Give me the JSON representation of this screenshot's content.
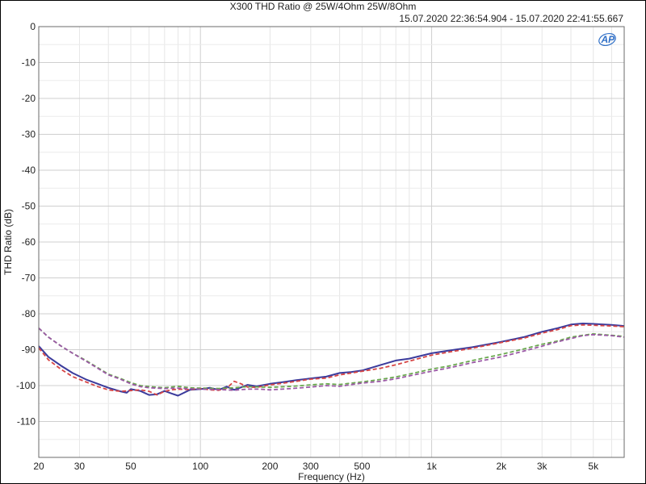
{
  "header": {
    "title": "X300 THD Ratio @ 25W/4Ohm 25W/8Ohm",
    "subtitle": "15.07.2020 22:36:54.904 - 15.07.2020 22:41:55.667",
    "logo_text": "AP"
  },
  "chart_data": {
    "type": "line",
    "title": "X300 THD Ratio @ 25W/4Ohm 25W/8Ohm",
    "subtitle": "15.07.2020 22:36:54.904 - 15.07.2020 22:41:55.667",
    "xlabel": "Frequency (Hz)",
    "ylabel": "THD Ratio (dB)",
    "x_scale": "log",
    "xlim": [
      20,
      6800
    ],
    "ylim": [
      -120,
      0
    ],
    "grid": true,
    "x_ticks": [
      {
        "value": 20,
        "label": "20"
      },
      {
        "value": 30,
        "label": "30"
      },
      {
        "value": 50,
        "label": "50"
      },
      {
        "value": 100,
        "label": "100"
      },
      {
        "value": 200,
        "label": "200"
      },
      {
        "value": 300,
        "label": "300"
      },
      {
        "value": 500,
        "label": "500"
      },
      {
        "value": 1000,
        "label": "1k"
      },
      {
        "value": 2000,
        "label": "2k"
      },
      {
        "value": 3000,
        "label": "3k"
      },
      {
        "value": 5000,
        "label": "5k"
      }
    ],
    "y_ticks": [
      {
        "value": 0,
        "label": "0"
      },
      {
        "value": -10,
        "label": "-10"
      },
      {
        "value": -20,
        "label": "-20"
      },
      {
        "value": -30,
        "label": "-30"
      },
      {
        "value": -40,
        "label": "-40"
      },
      {
        "value": -50,
        "label": "-50"
      },
      {
        "value": -60,
        "label": "-60"
      },
      {
        "value": -70,
        "label": "-70"
      },
      {
        "value": -80,
        "label": "-80"
      },
      {
        "value": -90,
        "label": "-90"
      },
      {
        "value": -100,
        "label": "-100"
      },
      {
        "value": -110,
        "label": "-110"
      }
    ],
    "series": [
      {
        "color": "#3b3b9c",
        "dash": "solid",
        "points": [
          [
            20,
            -89
          ],
          [
            22,
            -92
          ],
          [
            25,
            -94.5
          ],
          [
            28,
            -96.5
          ],
          [
            32,
            -98.3
          ],
          [
            36,
            -99.5
          ],
          [
            40,
            -100.6
          ],
          [
            45,
            -101.6
          ],
          [
            48,
            -102
          ],
          [
            50,
            -101
          ],
          [
            55,
            -101.5
          ],
          [
            60,
            -102.6
          ],
          [
            65,
            -102.4
          ],
          [
            70,
            -101.5
          ],
          [
            75,
            -102.2
          ],
          [
            80,
            -102.8
          ],
          [
            90,
            -101.2
          ],
          [
            100,
            -101
          ],
          [
            110,
            -100.6
          ],
          [
            120,
            -101.2
          ],
          [
            130,
            -100.3
          ],
          [
            140,
            -101.2
          ],
          [
            150,
            -100.5
          ],
          [
            160,
            -99.8
          ],
          [
            175,
            -100.2
          ],
          [
            200,
            -99.5
          ],
          [
            230,
            -99
          ],
          [
            260,
            -98.5
          ],
          [
            300,
            -98
          ],
          [
            350,
            -97.5
          ],
          [
            400,
            -96.5
          ],
          [
            450,
            -96.2
          ],
          [
            500,
            -95.8
          ],
          [
            600,
            -94.3
          ],
          [
            700,
            -93
          ],
          [
            800,
            -92.5
          ],
          [
            1000,
            -91
          ],
          [
            1200,
            -90.2
          ],
          [
            1500,
            -89.3
          ],
          [
            2000,
            -87.8
          ],
          [
            2500,
            -86.5
          ],
          [
            3000,
            -85
          ],
          [
            3500,
            -84
          ],
          [
            4000,
            -83
          ],
          [
            4500,
            -82.7
          ],
          [
            5000,
            -82.8
          ],
          [
            6000,
            -83.1
          ],
          [
            6800,
            -83.4
          ]
        ]
      },
      {
        "color": "#d64545",
        "dash": "dashed",
        "points": [
          [
            20,
            -89.5
          ],
          [
            22,
            -92.8
          ],
          [
            25,
            -95.5
          ],
          [
            28,
            -97.5
          ],
          [
            32,
            -99
          ],
          [
            36,
            -100.3
          ],
          [
            40,
            -101.2
          ],
          [
            45,
            -101.6
          ],
          [
            50,
            -101.4
          ],
          [
            55,
            -101.2
          ],
          [
            60,
            -101.6
          ],
          [
            65,
            -102.6
          ],
          [
            70,
            -101.6
          ],
          [
            75,
            -101.2
          ],
          [
            80,
            -101
          ],
          [
            90,
            -101.1
          ],
          [
            100,
            -100.8
          ],
          [
            110,
            -101.2
          ],
          [
            120,
            -101.3
          ],
          [
            130,
            -100.7
          ],
          [
            140,
            -98.8
          ],
          [
            150,
            -99.5
          ],
          [
            160,
            -100.4
          ],
          [
            175,
            -100.5
          ],
          [
            200,
            -99.8
          ],
          [
            230,
            -99.3
          ],
          [
            260,
            -98.8
          ],
          [
            300,
            -98.2
          ],
          [
            350,
            -97.9
          ],
          [
            400,
            -97
          ],
          [
            450,
            -96.5
          ],
          [
            500,
            -96
          ],
          [
            600,
            -95.2
          ],
          [
            700,
            -94.2
          ],
          [
            800,
            -93.2
          ],
          [
            1000,
            -91.5
          ],
          [
            1200,
            -90.6
          ],
          [
            1500,
            -89.6
          ],
          [
            2000,
            -88
          ],
          [
            2500,
            -86.8
          ],
          [
            3000,
            -85.4
          ],
          [
            3500,
            -84.4
          ],
          [
            4000,
            -83.3
          ],
          [
            4500,
            -83.1
          ],
          [
            5000,
            -83.2
          ],
          [
            6000,
            -83.4
          ],
          [
            6800,
            -83.6
          ]
        ]
      },
      {
        "color": "#6aa84f",
        "dash": "dashed",
        "points": [
          [
            20,
            -84
          ],
          [
            22,
            -86.5
          ],
          [
            25,
            -89
          ],
          [
            28,
            -91
          ],
          [
            32,
            -93
          ],
          [
            36,
            -95
          ],
          [
            40,
            -96.8
          ],
          [
            45,
            -98
          ],
          [
            50,
            -99.2
          ],
          [
            55,
            -100
          ],
          [
            60,
            -100.3
          ],
          [
            70,
            -100.6
          ],
          [
            80,
            -100.2
          ],
          [
            90,
            -100.6
          ],
          [
            100,
            -100.7
          ],
          [
            120,
            -100.8
          ],
          [
            140,
            -100.6
          ],
          [
            160,
            -100.3
          ],
          [
            180,
            -100.4
          ],
          [
            200,
            -100.5
          ],
          [
            250,
            -100.2
          ],
          [
            300,
            -99.8
          ],
          [
            350,
            -99.5
          ],
          [
            400,
            -99.7
          ],
          [
            450,
            -99.3
          ],
          [
            500,
            -99
          ],
          [
            600,
            -98.3
          ],
          [
            700,
            -97.6
          ],
          [
            800,
            -96.8
          ],
          [
            1000,
            -95.4
          ],
          [
            1200,
            -94.5
          ],
          [
            1500,
            -93
          ],
          [
            2000,
            -91.3
          ],
          [
            2500,
            -89.8
          ],
          [
            3000,
            -88.5
          ],
          [
            3500,
            -87.6
          ],
          [
            4000,
            -86.5
          ],
          [
            4500,
            -86
          ],
          [
            5000,
            -85.6
          ],
          [
            6000,
            -86
          ],
          [
            6800,
            -86.3
          ]
        ]
      },
      {
        "color": "#9b59a6",
        "dash": "dashed",
        "points": [
          [
            20,
            -84
          ],
          [
            22,
            -86.5
          ],
          [
            25,
            -89
          ],
          [
            28,
            -91
          ],
          [
            32,
            -93.2
          ],
          [
            36,
            -95.2
          ],
          [
            40,
            -97
          ],
          [
            45,
            -98.2
          ],
          [
            50,
            -99.5
          ],
          [
            55,
            -100.3
          ],
          [
            60,
            -100.6
          ],
          [
            70,
            -100.8
          ],
          [
            80,
            -100.7
          ],
          [
            90,
            -100.9
          ],
          [
            100,
            -101
          ],
          [
            120,
            -101.1
          ],
          [
            140,
            -101.3
          ],
          [
            160,
            -101
          ],
          [
            180,
            -101
          ],
          [
            200,
            -101.2
          ],
          [
            250,
            -100.8
          ],
          [
            300,
            -100.4
          ],
          [
            350,
            -100
          ],
          [
            400,
            -100.2
          ],
          [
            450,
            -99.7
          ],
          [
            500,
            -99.3
          ],
          [
            600,
            -98.8
          ],
          [
            700,
            -98.1
          ],
          [
            800,
            -97.3
          ],
          [
            1000,
            -96
          ],
          [
            1200,
            -95
          ],
          [
            1500,
            -93.6
          ],
          [
            2000,
            -92
          ],
          [
            2500,
            -90.4
          ],
          [
            3000,
            -89
          ],
          [
            3500,
            -87.8
          ],
          [
            4000,
            -86.9
          ],
          [
            4500,
            -86.1
          ],
          [
            5000,
            -85.8
          ],
          [
            6000,
            -86.1
          ],
          [
            6800,
            -86.5
          ]
        ]
      }
    ]
  }
}
